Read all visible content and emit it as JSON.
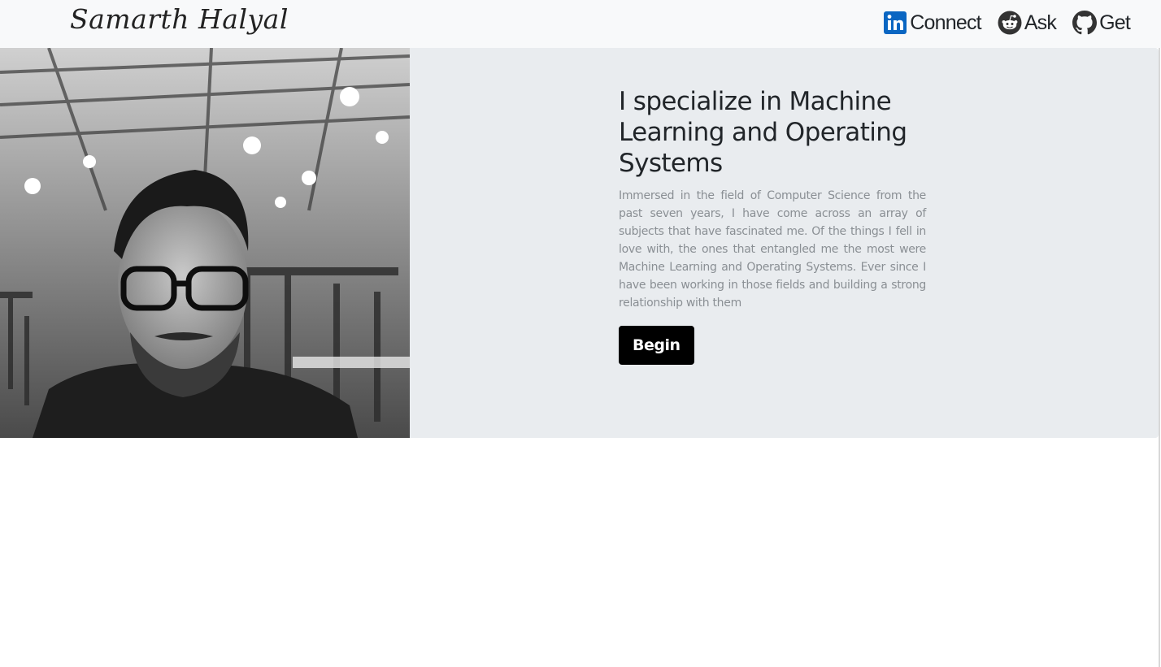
{
  "navbar": {
    "brand": "Samarth Halyal",
    "links": [
      {
        "label": "Connect",
        "icon": "linkedin-icon"
      },
      {
        "label": "Ask",
        "icon": "reddit-icon"
      },
      {
        "label": "Get",
        "icon": "github-icon"
      }
    ]
  },
  "hero": {
    "headline": "I specialize in Machine Learning and Operating Systems",
    "description": "Immersed in the field of Computer Science from the past seven years, I have come across an array of subjects that have fascinated me. Of the things I fell in love with, the ones that entangled me the most were Machine Learning and Operating Systems. Ever since I have been working in those fields and building a strong relationship with them",
    "button_label": "Begin"
  },
  "colors": {
    "navbar_bg": "#f8f9fa",
    "hero_bg": "#e9ecef",
    "button_bg": "#000000",
    "linkedin_blue": "#0a66c2"
  }
}
